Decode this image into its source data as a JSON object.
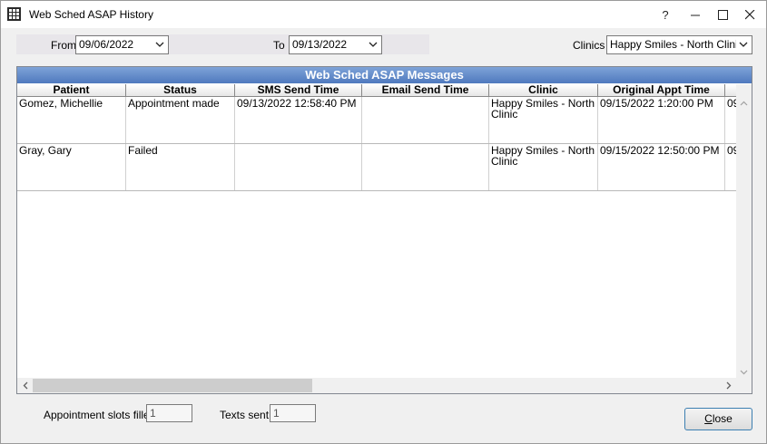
{
  "window": {
    "title": "Web Sched ASAP History",
    "help": "?",
    "minimize": "–",
    "maximize": "☐",
    "close": "✕"
  },
  "filters": {
    "from_label": "From",
    "from_value": "09/06/2022",
    "to_label": "To",
    "to_value": "09/13/2022",
    "clinics_label": "Clinics",
    "clinics_value": "Happy Smiles - North Clinic"
  },
  "grid": {
    "title": "Web Sched ASAP Messages",
    "columns": [
      "Patient",
      "Status",
      "SMS Send Time",
      "Email Send Time",
      "Clinic",
      "Original Appt Time",
      ""
    ],
    "rows": [
      [
        "Gomez, Michellie",
        "Appointment made",
        "09/13/2022 12:58:40 PM",
        "",
        "Happy Smiles - North Clinic",
        "09/15/2022 1:20:00 PM",
        "09"
      ],
      [
        "Gray, Gary",
        "Failed",
        "",
        "",
        "Happy Smiles - North Clinic",
        "09/15/2022 12:50:00 PM",
        "09"
      ]
    ]
  },
  "footer": {
    "slots_label": "Appointment slots filled",
    "slots_value": "1",
    "texts_label": "Texts sent",
    "texts_value": "1",
    "close_label_first": "C",
    "close_label_rest": "lose"
  }
}
